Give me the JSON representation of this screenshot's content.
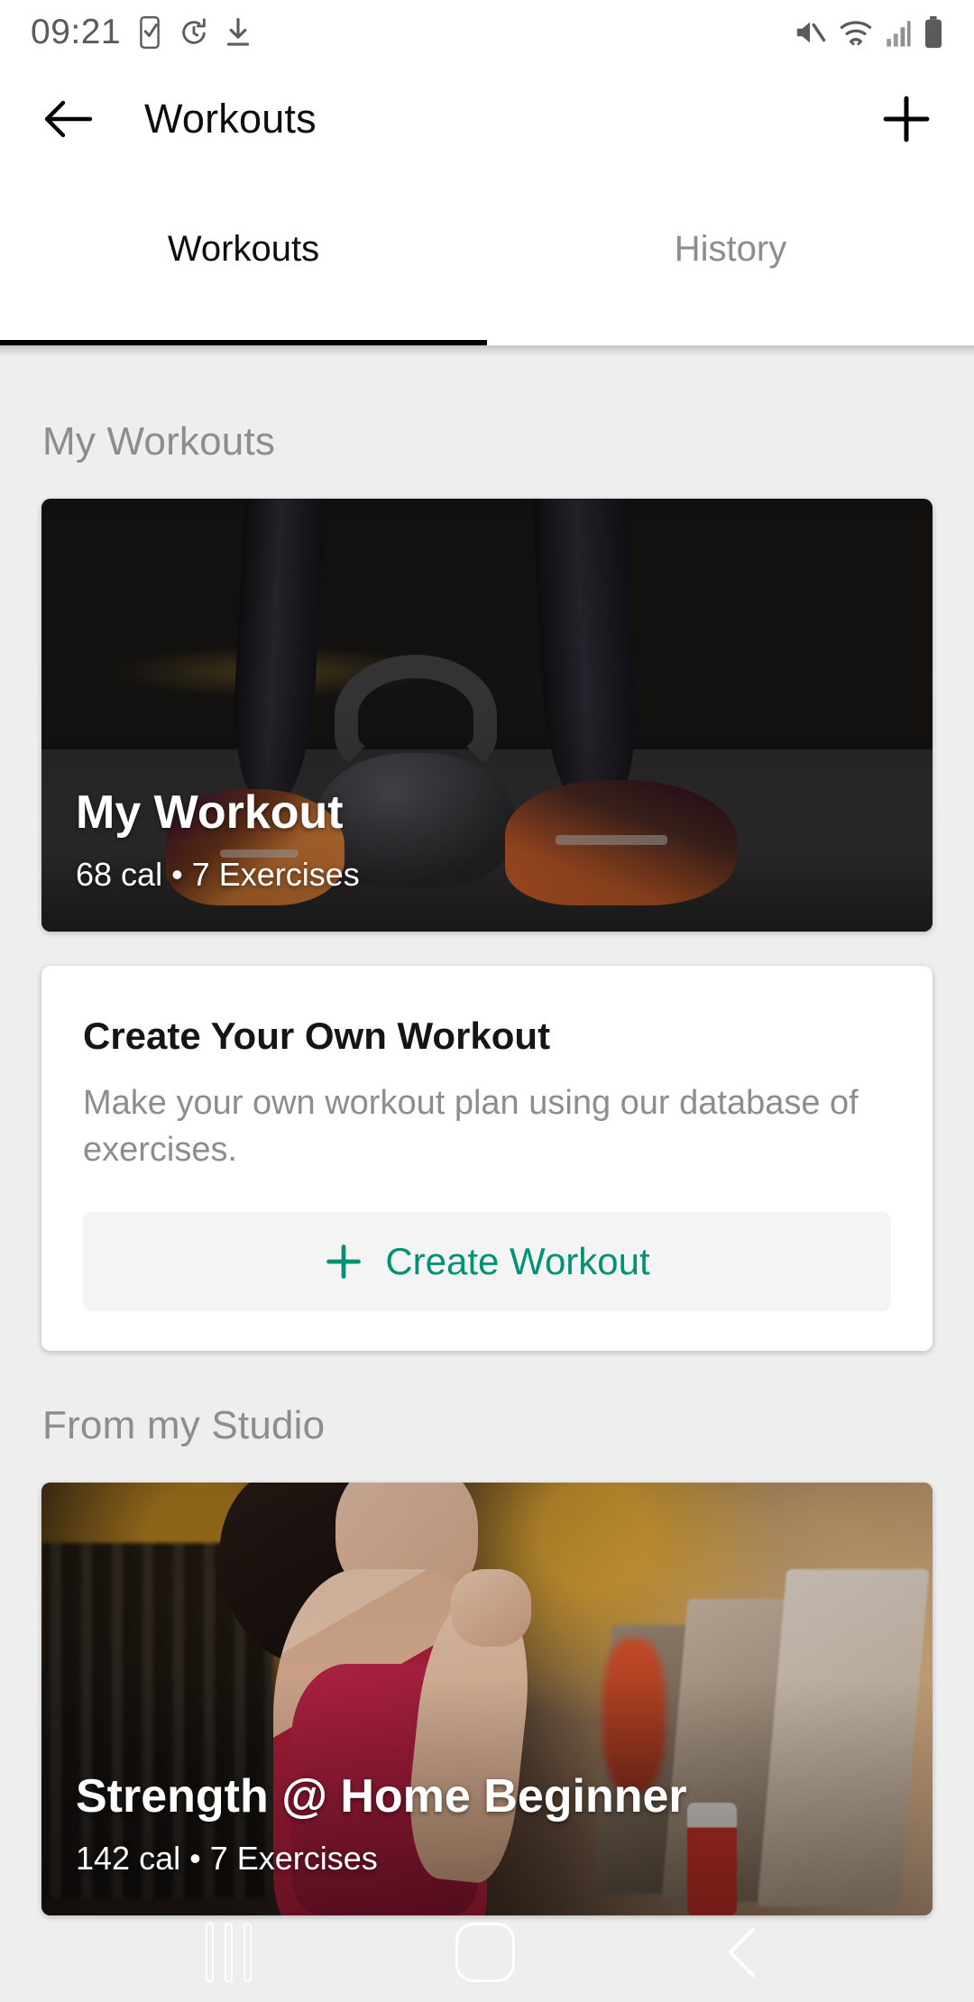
{
  "status_bar": {
    "time": "09:21",
    "left_icons": [
      "task-check-icon",
      "timer-icon",
      "download-icon"
    ],
    "right_icons": [
      "mute-icon",
      "wifi-icon",
      "signal-icon",
      "battery-icon"
    ]
  },
  "app_bar": {
    "back_icon": "back-arrow-icon",
    "title": "Workouts",
    "add_icon": "plus-icon"
  },
  "tabs": [
    {
      "label": "Workouts",
      "active": true
    },
    {
      "label": "History",
      "active": false
    }
  ],
  "sections": {
    "my_workouts": {
      "title": "My Workouts",
      "workout_card": {
        "title": "My Workout",
        "subtitle": "68 cal • 7 Exercises",
        "calories": "68 cal",
        "exercises": "7 Exercises",
        "image": "kettlebell-legs-photo"
      },
      "create_card": {
        "title": "Create Your Own Workout",
        "description": "Make your own workout plan using our database of exercises.",
        "button_label": "Create Workout",
        "button_icon": "plus-icon"
      }
    },
    "studio": {
      "title": "From my Studio",
      "workout_card": {
        "title": "Strength @ Home Beginner",
        "subtitle": "142 cal • 7 Exercises",
        "calories": "142 cal",
        "exercises": "7 Exercises",
        "image": "gym-treadmill-woman-photo"
      }
    }
  },
  "nav_bar": {
    "recents_icon": "recents-icon",
    "home_icon": "home-icon",
    "back_icon": "back-icon"
  },
  "colors": {
    "accent_green": "#009273",
    "background": "#eeeeee",
    "surface": "#ffffff",
    "muted_text": "#8d8d8d",
    "primary_text": "#0d0d0d"
  }
}
